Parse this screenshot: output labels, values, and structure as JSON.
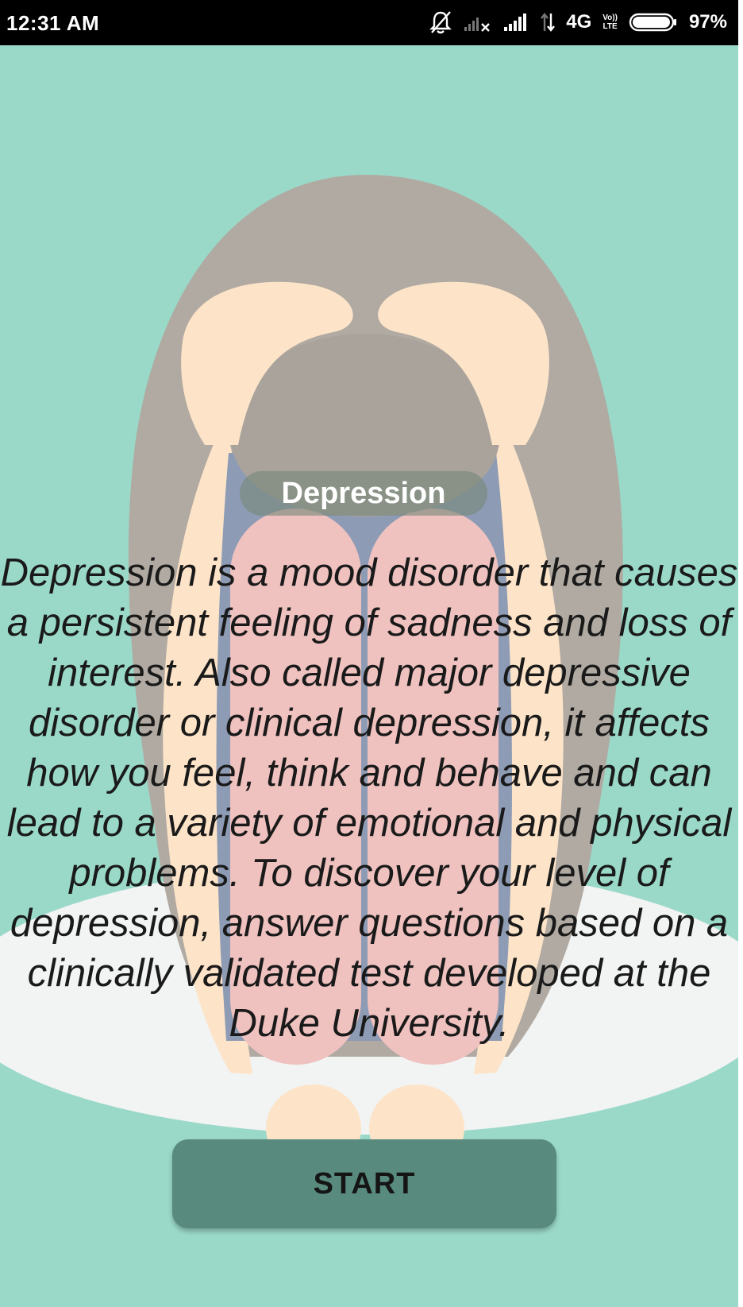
{
  "status_bar": {
    "time": "12:31 AM",
    "network_type": "4G",
    "lte_badge_top": "Vo))",
    "lte_badge_bottom": "LTE",
    "battery_percent": "97%",
    "battery_level": 0.97,
    "icons": [
      "alarm-off-icon",
      "signal-x-icon",
      "signal-icon",
      "data-arrows-icon",
      "volte-icon",
      "battery-icon"
    ]
  },
  "main": {
    "title": "Depression",
    "description": "Depression is a mood disorder that causes a persistent feeling of sadness and loss of interest. Also called major depressive disorder or clinical depression, it affects how you feel, think and behave and can lead to a variety of emotional and physical problems. To discover your level of depression, answer questions based on a clinically validated test developed at the Duke University.",
    "start_label": "START"
  },
  "colors": {
    "background": "#9ad9c8",
    "hair": "#b0aaa2",
    "skin": "#fde4c8",
    "dress": "#8e9bb4",
    "legs": "#efc2bf",
    "floor": "#f2f3f3",
    "button": "#598a7e"
  }
}
